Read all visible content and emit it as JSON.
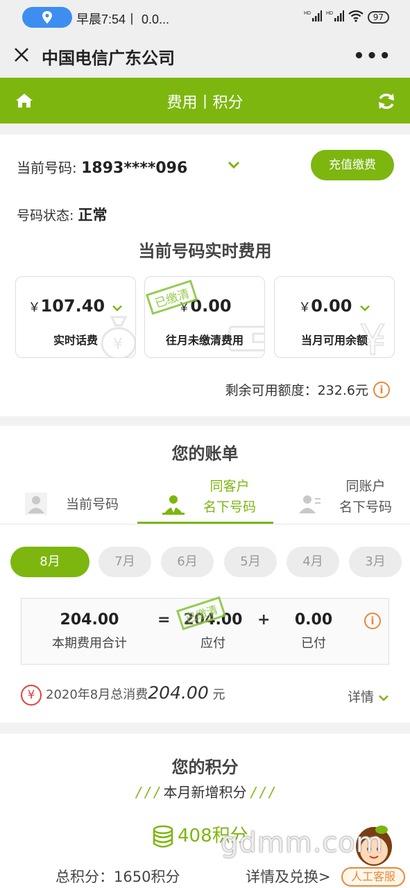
{
  "status_bar": {
    "time": "早晨7:54丨 0.0...",
    "battery": "97",
    "network": "HD"
  },
  "app": {
    "title": "中国电信广东公司",
    "more": "•••"
  },
  "header": {
    "title": "费用丨积分"
  },
  "number_section": {
    "number_label": "当前号码: ",
    "number_value": "1893****096",
    "recharge_button": "充值缴费",
    "status_label": "号码状态: ",
    "status_value": "正常",
    "realtime_title": "当前号码实时费用",
    "cards": [
      {
        "currency": "￥",
        "amount": "107.40",
        "caption": "实时话费"
      },
      {
        "currency": "￥",
        "amount": "0.00",
        "caption": "往月未缴清费用",
        "stamp": "已缴清"
      },
      {
        "currency": "￥",
        "amount": "0.00",
        "caption": "当月可用余额"
      }
    ],
    "remaining": "剩余可用额度：232.6元"
  },
  "bill": {
    "title": "您的账单",
    "tabs": [
      {
        "line1": "当前号码",
        "line2": ""
      },
      {
        "line1": "同客户",
        "line2": "名下号码"
      },
      {
        "line1": "同账户",
        "line2": "名下号码"
      }
    ],
    "active_tab": 1,
    "months": [
      "8月",
      "7月",
      "6月",
      "5月",
      "4月",
      "3月"
    ],
    "active_month": 0,
    "summary": {
      "total": "204.00",
      "total_label": "本期费用合计",
      "eq": "=",
      "due": "204.00",
      "due_label": "应付",
      "plus": "+",
      "paid": "0.00",
      "paid_label": "已付",
      "stamp": "已缴清"
    },
    "month_total_prefix": "2020年8月总消费",
    "month_total_amount": "204.00",
    "month_total_unit": " 元",
    "details": "详情"
  },
  "points": {
    "title": "您的积分",
    "subtitle_slashes": "/ / /",
    "subtitle": "本月新增积分",
    "new_points": "408积分",
    "total": "总积分：1650积分",
    "detail_link": "详情及兑换>",
    "service": "人工客服"
  },
  "watermark": "gdmm.com",
  "colors": {
    "brand_green": "#7db60f",
    "accent_orange": "#e8883a",
    "accent_red": "#e04040"
  }
}
